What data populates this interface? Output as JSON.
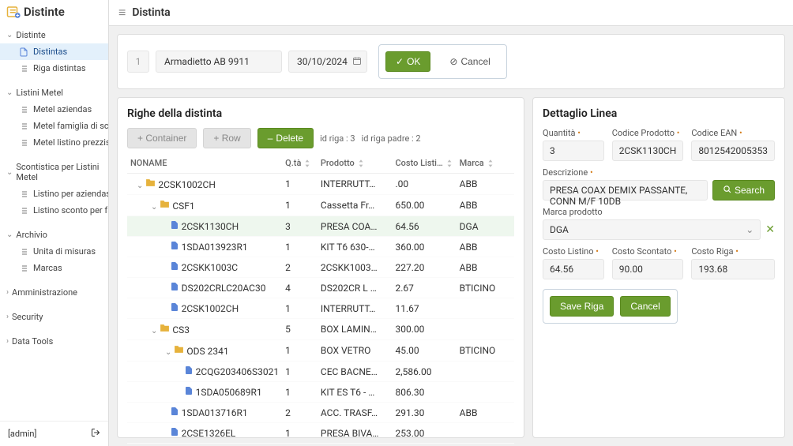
{
  "brand": "Distinte",
  "sidebar": {
    "groups": [
      {
        "label": "Distinte",
        "items": [
          {
            "label": "Distintas",
            "selected": true
          },
          {
            "label": "Riga distintas"
          }
        ]
      },
      {
        "label": "Listini Metel",
        "items": [
          {
            "label": "Metel aziendas"
          },
          {
            "label": "Metel famiglia di scontoes"
          },
          {
            "label": "Metel listino prezzis"
          }
        ]
      },
      {
        "label": "Scontistica per Listini Metel",
        "items": [
          {
            "label": "Listino per aziendas"
          },
          {
            "label": "Listino sconto per famigli…"
          }
        ]
      },
      {
        "label": "Archivio",
        "items": [
          {
            "label": "Unita di misuras"
          },
          {
            "label": "Marcas"
          }
        ]
      }
    ],
    "collapsed": [
      {
        "label": "Amministrazione"
      },
      {
        "label": "Security"
      },
      {
        "label": "Data Tools"
      }
    ],
    "user": "[admin]"
  },
  "page": {
    "title": "Distinta",
    "header_id": "1",
    "header_name": "Armadietto AB 9911",
    "header_date": "30/10/2024",
    "ok": "OK",
    "cancel": "Cancel"
  },
  "rows": {
    "title": "Righe della distinta",
    "buttons": {
      "container": "+  Container",
      "row": "+  Row",
      "delete": "Delete"
    },
    "meta": {
      "idriga": "id riga : 3",
      "idrigapadre": "id riga padre : 2"
    },
    "columns": {
      "name": "NONAME",
      "qta": "Q.tà",
      "prodotto": "Prodotto",
      "costo": "Costo Listi…",
      "marca": "Marca"
    },
    "data": [
      {
        "level": 0,
        "type": "folder",
        "open": "v",
        "name": "2CSK1002CH",
        "qta": "1",
        "prodotto": "INTERRUTT…",
        "costo": ".00",
        "marca": "ABB"
      },
      {
        "level": 1,
        "type": "folder",
        "open": "v",
        "name": "CSF1",
        "qta": "1",
        "prodotto": "Cassetta Fr…",
        "costo": "650.00",
        "marca": "ABB"
      },
      {
        "level": 2,
        "type": "file",
        "name": "2CSK1130CH",
        "qta": "3",
        "prodotto": "PRESA COA…",
        "costo": "64.56",
        "marca": "DGA",
        "selected": true
      },
      {
        "level": 2,
        "type": "file",
        "name": "1SDA013923R1",
        "qta": "1",
        "prodotto": "KIT T6 630-…",
        "costo": "360.00",
        "marca": "ABB"
      },
      {
        "level": 2,
        "type": "file",
        "name": "2CSKK1003C",
        "qta": "2",
        "prodotto": "2CSKK1003…",
        "costo": "227.20",
        "marca": "ABB"
      },
      {
        "level": 2,
        "type": "file",
        "name": "DS202CRLC20AC30",
        "qta": "4",
        "prodotto": "DS202CR L …",
        "costo": "2.67",
        "marca": "BTICINO"
      },
      {
        "level": 2,
        "type": "file",
        "name": "2CSK1002CH",
        "qta": "1",
        "prodotto": "INTERRUTT…",
        "costo": "11.67",
        "marca": ""
      },
      {
        "level": 1,
        "type": "folder",
        "open": "v",
        "name": "CS3",
        "qta": "5",
        "prodotto": "BOX LAMIN…",
        "costo": "300.00",
        "marca": ""
      },
      {
        "level": 2,
        "type": "folder",
        "open": "v",
        "name": "ODS 2341",
        "qta": "1",
        "prodotto": "BOX VETRO",
        "costo": "45.00",
        "marca": "BTICINO"
      },
      {
        "level": 3,
        "type": "file",
        "name": "2CQG203406S3021",
        "qta": "1",
        "prodotto": "CEC BACNE…",
        "costo": "2,586.00",
        "marca": ""
      },
      {
        "level": 3,
        "type": "file",
        "name": "1SDA050689R1",
        "qta": "1",
        "prodotto": "KIT ES T6 - …",
        "costo": "806.30",
        "marca": ""
      },
      {
        "level": 2,
        "type": "file",
        "name": "1SDA013716R1",
        "qta": "2",
        "prodotto": "ACC. TRASF…",
        "costo": "291.30",
        "marca": "ABB"
      },
      {
        "level": 2,
        "type": "file",
        "name": "2CSE1326EL",
        "qta": "1",
        "prodotto": "PRESA BIVA…",
        "costo": "253.00",
        "marca": ""
      }
    ]
  },
  "detail": {
    "title": "Dettaglio Linea",
    "labels": {
      "quantita": "Quantità",
      "codice": "Codice Prodotto",
      "ean": "Codice EAN",
      "descrizione": "Descrizione",
      "marca": "Marca prodotto",
      "listino": "Costo Listino",
      "scontato": "Costo Scontato",
      "riga": "Costo Riga"
    },
    "values": {
      "quantita": "3",
      "codice": "2CSK1130CH",
      "ean": "8012542005353",
      "descrizione": "PRESA COAX DEMIX PASSANTE, CONN M/F 10DB",
      "marca": "DGA",
      "listino": "64.56",
      "scontato": "90.00",
      "riga": "193.68"
    },
    "buttons": {
      "search": "Search",
      "save": "Save Riga",
      "cancel": "Cancel"
    }
  }
}
